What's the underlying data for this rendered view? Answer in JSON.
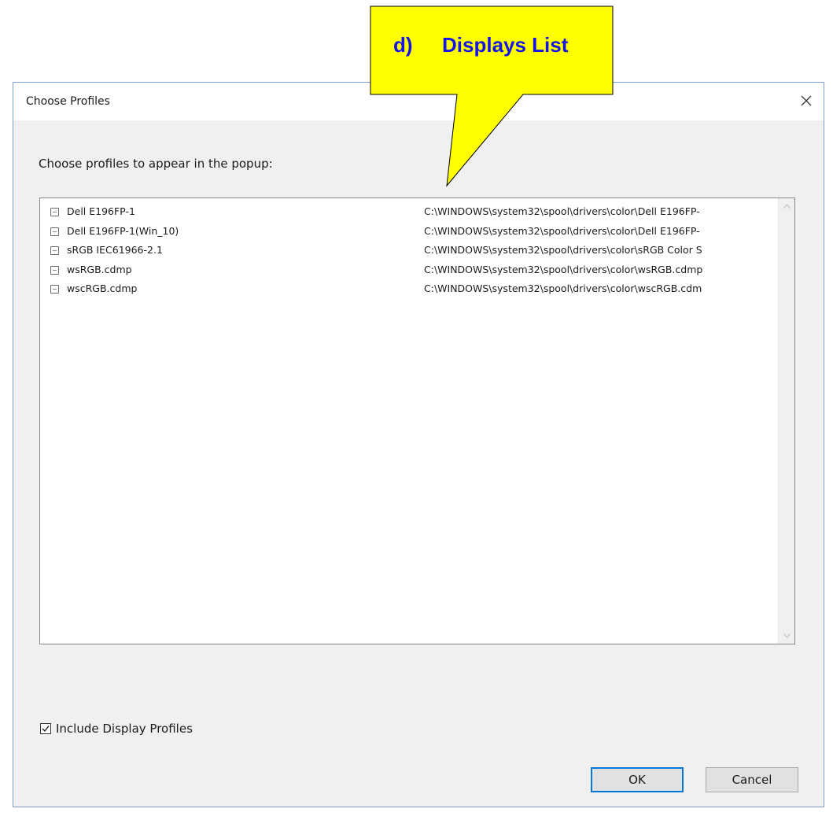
{
  "annotation": {
    "prefix": "d)",
    "title": "Displays List",
    "fill_color": "#ffff00",
    "text_color": "#1414e6"
  },
  "dialog": {
    "title": "Choose Profiles",
    "close_icon": "close-icon",
    "prompt": "Choose profiles to appear in the popup:"
  },
  "profiles": [
    {
      "name": "Dell E196FP-1",
      "path": "C:\\WINDOWS\\system32\\spool\\drivers\\color\\Dell E196FP-",
      "checked": false
    },
    {
      "name": "Dell E196FP-1(Win_10)",
      "path": "C:\\WINDOWS\\system32\\spool\\drivers\\color\\Dell E196FP-",
      "checked": false
    },
    {
      "name": "sRGB IEC61966-2.1",
      "path": "C:\\WINDOWS\\system32\\spool\\drivers\\color\\sRGB Color S",
      "checked": false
    },
    {
      "name": "wsRGB.cdmp",
      "path": "C:\\WINDOWS\\system32\\spool\\drivers\\color\\wsRGB.cdmp",
      "checked": false
    },
    {
      "name": "wscRGB.cdmp",
      "path": "C:\\WINDOWS\\system32\\spool\\drivers\\color\\wscRGB.cdm",
      "checked": false
    }
  ],
  "include_display_profiles": {
    "label": "Include Display Profiles",
    "checked": true
  },
  "buttons": {
    "ok": "OK",
    "cancel": "Cancel"
  },
  "colors": {
    "dialog_border": "#7a9ccf",
    "default_button_border": "#0078d7"
  }
}
